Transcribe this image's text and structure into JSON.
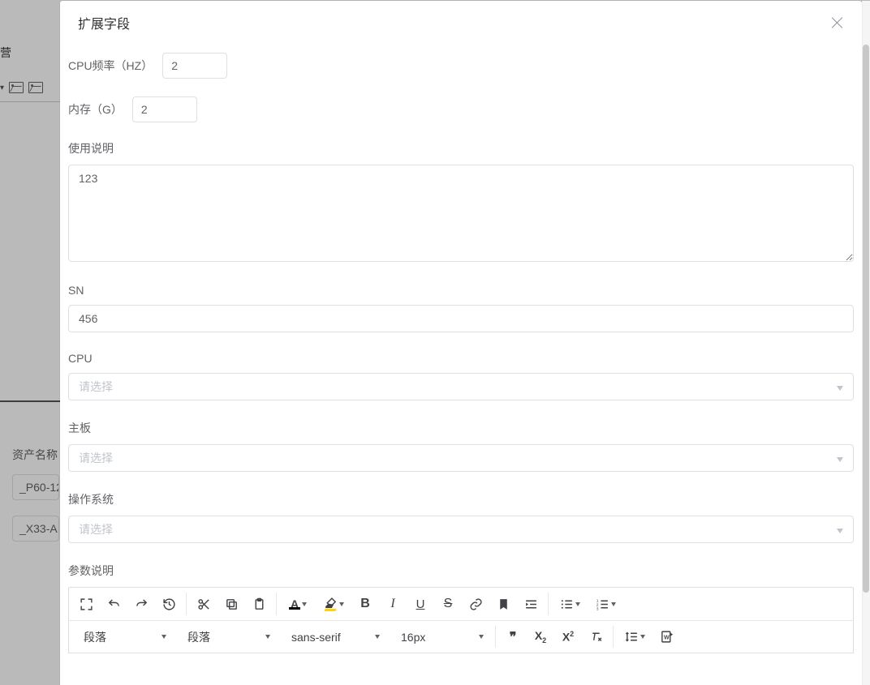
{
  "background": {
    "top_text": "营",
    "asset_label": "资产名称",
    "input1": "_P60-12",
    "input2": "_X33-A"
  },
  "dialog": {
    "title": "扩展字段",
    "cpu_freq_label": "CPU频率（HZ）",
    "cpu_freq_value": "2",
    "ram_label": "内存（G）",
    "ram_value": "2",
    "usage_label": "使用说明",
    "usage_value": "123",
    "sn_label": "SN",
    "sn_value": "456",
    "cpu_label": "CPU",
    "mb_label": "主板",
    "os_label": "操作系统",
    "select_placeholder": "请选择",
    "param_label": "参数说明",
    "editor": {
      "para1": "段落",
      "para2": "段落",
      "font": "sans-serif",
      "size": "16px"
    }
  }
}
